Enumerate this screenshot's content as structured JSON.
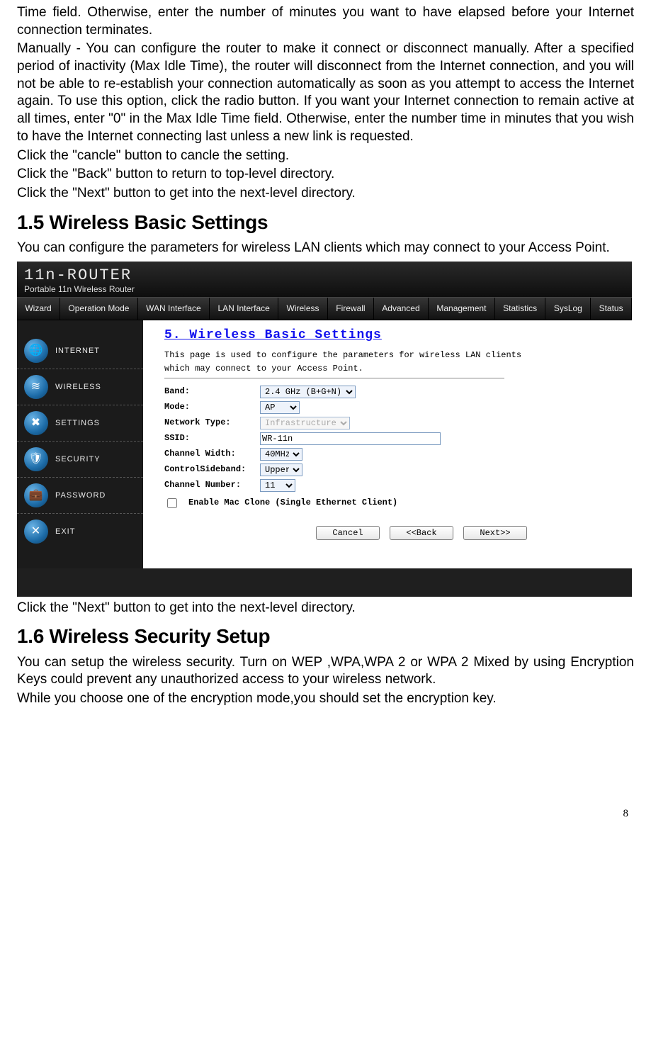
{
  "body": {
    "p1": "Time field. Otherwise, enter the number of minutes you want to have elapsed before your Internet connection terminates.",
    "p2": "Manually - You can configure the router to make it connect or disconnect manually. After a specified period of inactivity (Max Idle Time), the router will disconnect from the Internet connection, and you will not be able to re-establish your connection automatically as soon as you attempt to access the Internet again. To use this option, click the radio button. If you want your Internet connection to remain active at all times, enter \"0\" in the Max Idle Time field. Otherwise, enter the number time in minutes that you wish to have the Internet connecting last unless a new link is requested.",
    "p3": "Click the  \"cancle\" button to cancle the setting.",
    "p4": "Click the \"Back\" button to return to top-level directory.",
    "p5": "Click the \"Next\" button to get into the next-level directory.",
    "h1": "1.5 Wireless Basic Settings",
    "p6": "You can configure the parameters for wireless LAN clients which may connect to your Access Point.",
    "p7": "Click the \"Next\" button to get into the next-level directory.",
    "h2": "1.6 Wireless Security Setup",
    "p8": "You can setup the wireless security. Turn on WEP ,WPA,WPA 2 or WPA 2 Mixed by using Encryption Keys could prevent any unauthorized access to your wireless network.",
    "p9": "While you choose one of the encryption mode,you should set the encryption key."
  },
  "router": {
    "logo_top": "11n-ROUTER",
    "logo_sub": "Portable 11n Wireless Router",
    "topnav": [
      "Wizard",
      "Operation Mode",
      "WAN Interface",
      "LAN Interface",
      "Wireless",
      "Firewall",
      "Advanced",
      "Management",
      "Statistics",
      "SysLog",
      "Status"
    ],
    "sidebar": [
      {
        "label": "INTERNET",
        "icon": "globe-icon",
        "glyph": "🌐"
      },
      {
        "label": "WIRELESS",
        "icon": "wifi-icon",
        "glyph": "≋"
      },
      {
        "label": "SETTINGS",
        "icon": "wrench-icon",
        "glyph": "✖"
      },
      {
        "label": "SECURITY",
        "icon": "shield-icon",
        "glyph": "🛡"
      },
      {
        "label": "PASSWORD",
        "icon": "briefcase-icon",
        "glyph": "💼"
      },
      {
        "label": "EXIT",
        "icon": "close-icon",
        "glyph": "✕"
      }
    ],
    "content": {
      "title": "5. Wireless Basic Settings",
      "desc1": "This page is used to configure the parameters for wireless LAN clients",
      "desc2": "which may connect to your Access Point.",
      "fields": {
        "band": {
          "label": "Band:",
          "value": "2.4 GHz (B+G+N)"
        },
        "mode": {
          "label": "Mode:",
          "value": "AP"
        },
        "network_type": {
          "label": "Network Type:",
          "value": "Infrastructure"
        },
        "ssid": {
          "label": "SSID:",
          "value": "WR-11n"
        },
        "channel_width": {
          "label": "Channel Width:",
          "value": "40MHz"
        },
        "control_sideband": {
          "label": "ControlSideband:",
          "value": "Upper"
        },
        "channel_number": {
          "label": "Channel Number:",
          "value": "11"
        }
      },
      "macclone": "Enable Mac Clone (Single Ethernet Client)",
      "buttons": {
        "cancel": "Cancel",
        "back": "<<Back",
        "next": "Next>>"
      }
    }
  },
  "page_number": "8"
}
